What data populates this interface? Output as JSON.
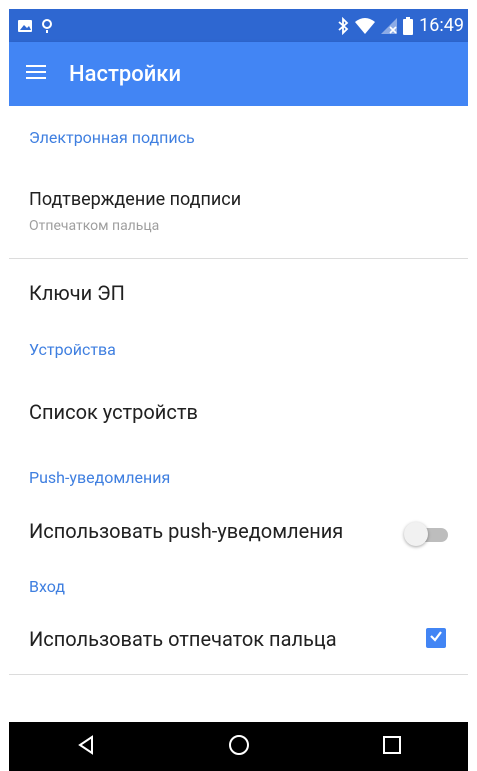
{
  "status_bar": {
    "time": "16:49",
    "left_icons": [
      "image-icon",
      "location-pin-icon"
    ],
    "right_icons": [
      "bluetooth-icon",
      "wifi-icon",
      "cellular-no-signal-icon",
      "battery-icon"
    ]
  },
  "toolbar": {
    "title": "Настройки",
    "menu_icon": "hamburger-menu-icon",
    "color": "#4285f4"
  },
  "sections": {
    "signature": {
      "header": "Электронная подпись",
      "confirm_title": "Подтверждение подписи",
      "confirm_summary": "Отпечатком пальца",
      "keys_title": "Ключи ЭП"
    },
    "devices": {
      "header": "Устройства",
      "list_title": "Список устройств"
    },
    "push": {
      "header": "Push-уведомления",
      "use_push_title": "Использовать push-уведомления",
      "use_push_enabled": false
    },
    "login": {
      "header": "Вход",
      "fingerprint_title": "Использовать отпечаток пальца",
      "fingerprint_checked": true
    }
  },
  "nav_bar": {
    "icons": [
      "back-icon",
      "home-icon",
      "recents-icon"
    ]
  },
  "colors": {
    "status_bar": "#2e67d1",
    "accent": "#4285f4",
    "section_header": "#3f7fe0"
  }
}
